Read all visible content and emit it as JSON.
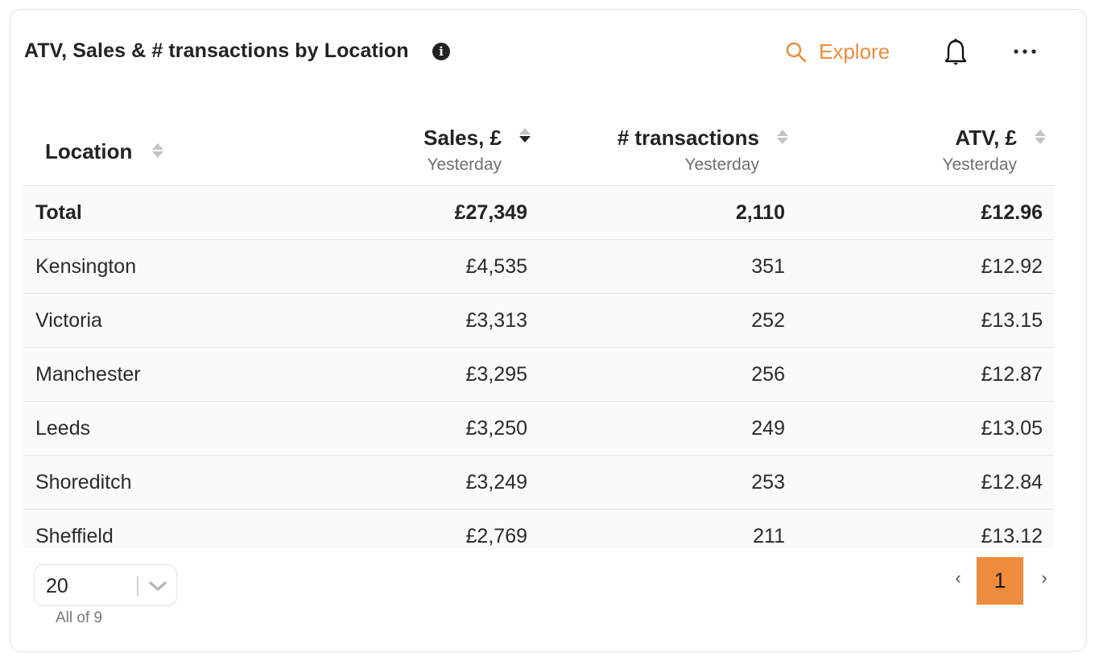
{
  "header": {
    "title": "ATV, Sales & # transactions by Location",
    "info_icon": "info-icon",
    "explore_label": "Explore",
    "explore_icon": "search-icon",
    "alert_icon": "bell-icon",
    "more_icon": "more-horizontal-icon",
    "accent_color": "#ef8b3d"
  },
  "table": {
    "columns": [
      {
        "label": "Location",
        "sub": "",
        "sort": "none"
      },
      {
        "label": "Sales, £",
        "sub": "Yesterday",
        "sort": "descending"
      },
      {
        "label": "# transactions",
        "sub": "Yesterday",
        "sort": "none"
      },
      {
        "label": "ATV, £",
        "sub": "Yesterday",
        "sort": "none"
      }
    ],
    "total": {
      "location": "Total",
      "sales": "£27,349",
      "transactions": "2,110",
      "atv": "£12.96"
    },
    "rows": [
      {
        "location": "Kensington",
        "sales": "£4,535",
        "transactions": "351",
        "atv": "£12.92"
      },
      {
        "location": "Victoria",
        "sales": "£3,313",
        "transactions": "252",
        "atv": "£13.15"
      },
      {
        "location": "Manchester",
        "sales": "£3,295",
        "transactions": "256",
        "atv": "£12.87"
      },
      {
        "location": "Leeds",
        "sales": "£3,250",
        "transactions": "249",
        "atv": "£13.05"
      },
      {
        "location": "Shoreditch",
        "sales": "£3,249",
        "transactions": "253",
        "atv": "£12.84"
      },
      {
        "location": "Sheffield",
        "sales": "£2,769",
        "transactions": "211",
        "atv": "£13.12"
      }
    ]
  },
  "footer": {
    "page_size": "20",
    "record_count": "All of 9",
    "prev_label": "‹",
    "next_label": "›",
    "current_page": "1"
  }
}
